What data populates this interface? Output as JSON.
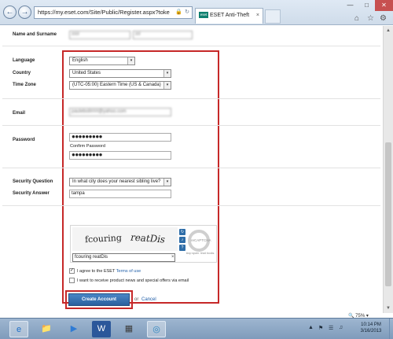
{
  "browser": {
    "url": "https://my.eset.com/Site/Public/Register.aspx?toke",
    "tab_title": "ESET Anti-Theft",
    "tab_favicon": "eset",
    "nav_back_icon": "←",
    "nav_forward_icon": "→",
    "lock_icon": "🔒",
    "refresh_icon": "↻",
    "tab_close_icon": "×",
    "window": {
      "minimize": "—",
      "maximize": "□",
      "close": "✕"
    },
    "toolbar_icons": {
      "home": "⌂",
      "favorites": "☆",
      "tools": "⚙"
    }
  },
  "form": {
    "name_label": "Name and Surname",
    "first_name_value": "###",
    "last_name_value": "##",
    "language_label": "Language",
    "language_value": "English",
    "country_label": "Country",
    "country_value": "United States",
    "timezone_label": "Time Zone",
    "timezone_value": "(UTC-05:00) Eastern Time (US & Canada)",
    "email_label": "Email",
    "email_value": "pauleboll###@yahoo.com",
    "password_label": "Password",
    "password_mask": "●●●●●●●●●",
    "confirm_password_label": "Confirm Password",
    "confirm_password_mask": "●●●●●●●●●",
    "security_question_label": "Security Question",
    "security_question_value": "In what city does your nearest sibling live?",
    "security_answer_label": "Security Answer",
    "security_answer_value": "tampa",
    "captcha": {
      "word1": "fcouring",
      "word2": "reatDis",
      "input_value": "fcouring reatDis",
      "clear_icon": "×",
      "reload_icon": "↻",
      "audio_icon": "♪",
      "help_icon": "?",
      "logo_text": "reCAPTCHA",
      "tagline": "stop spam. read books."
    },
    "terms_prefix": "I agree to the ESET ",
    "terms_link": "Terms of use",
    "newsletter_label": "I want to receive product news and special offers via email",
    "terms_checked": "✓",
    "create_button": "Create Account",
    "or_text": "or",
    "cancel_link": "Cancel"
  },
  "status": {
    "zoom": "75%",
    "zoom_icon": "🔍",
    "dropdown_icon": "▾"
  },
  "taskbar": {
    "ie_icon": "e",
    "explorer_icon": "📁",
    "media_icon": "▶",
    "word_icon": "W",
    "app_icon": "▦",
    "target_icon": "◎",
    "tray_up": "▲",
    "tray_flag": "⚑",
    "tray_network": "☰",
    "tray_volume": "♫",
    "time": "10:14 PM",
    "date": "3/16/2013"
  },
  "colors": {
    "highlight_box": "#c62828",
    "button": "#2a609e",
    "link": "#1f5ea8"
  }
}
